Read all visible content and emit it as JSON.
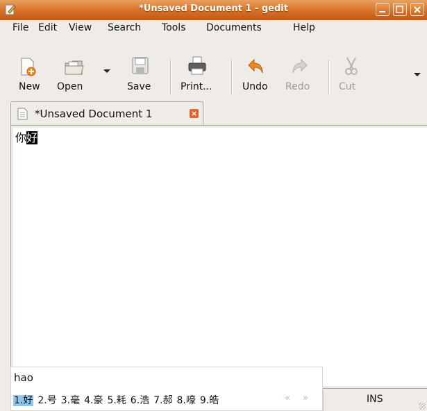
{
  "window": {
    "title": "*Unsaved Document 1 - gedit"
  },
  "menu": [
    "File",
    "Edit",
    "View",
    "Search",
    "Tools",
    "Documents",
    "Help"
  ],
  "toolbar": {
    "new": "New",
    "open": "Open",
    "save": "Save",
    "print": "Print...",
    "undo": "Undo",
    "redo": "Redo",
    "cut": "Cut"
  },
  "tab": {
    "label": "*Unsaved Document 1"
  },
  "editor": {
    "text_plain": "你",
    "text_selected": "好"
  },
  "ime": {
    "preedit": "hao",
    "candidates": [
      "1.好",
      "2.号",
      "3.毫",
      "4.豪",
      "5.耗",
      "6.浩",
      "7.郝",
      "8.嚎",
      "9.皓"
    ],
    "prev": "«",
    "next": "»"
  },
  "status": {
    "mode": "INS"
  },
  "colors": {
    "titlebar": "#d66f24",
    "selection": "#000000",
    "candidate_highlight": "#8ec7ee"
  }
}
